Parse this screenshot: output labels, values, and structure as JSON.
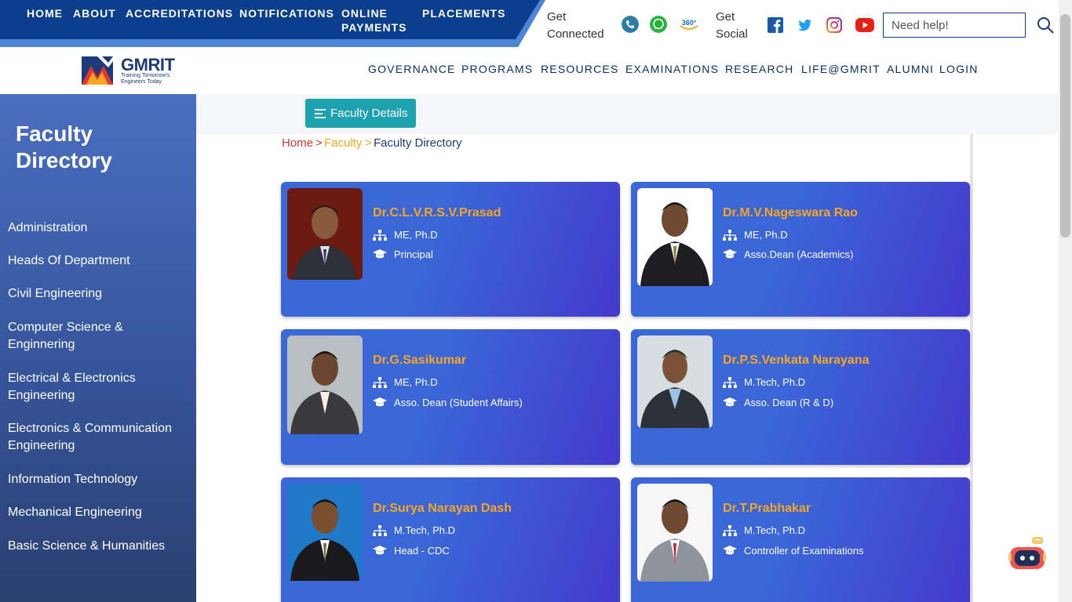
{
  "topnav": {
    "items": [
      "HOME",
      "ABOUT",
      "ACCREDITATIONS",
      "NOTIFICATIONS",
      "ONLINE PAYMENTS",
      "PLACEMENTS"
    ]
  },
  "connect": {
    "get_connected": "Get Connected",
    "get_social": "Get Social",
    "icons": [
      "phone-icon",
      "whatsapp-icon",
      "360-icon"
    ],
    "social": [
      "facebook-icon",
      "twitter-icon",
      "instagram-icon",
      "youtube-icon"
    ]
  },
  "search": {
    "placeholder": "Need help!"
  },
  "logo": {
    "name": "GMRIT",
    "tagline_1": "Training Tomorrow's",
    "tagline_2": "Engineers Today"
  },
  "mainnav": {
    "items": [
      "GOVERNANCE",
      "PROGRAMS",
      "RESOURCES",
      "EXAMINATIONS",
      "RESEARCH",
      "LIFE@GMRIT",
      "ALUMNI",
      "LOGIN"
    ]
  },
  "sidebar": {
    "title": "Faculty Directory",
    "items": [
      "Administration",
      "Heads Of Department",
      "Civil Engineering",
      "Computer Science & Enginnering",
      "Electrical & Electronics Engineering",
      "Electronics & Communication Engineering",
      "Information Technology",
      "Mechanical Engineering",
      "Basic Science & Humanities"
    ]
  },
  "faculty_button": {
    "label": "Faculty Details"
  },
  "breadcrumb": {
    "home": "Home",
    "sep": ">",
    "faculty": "Faculty",
    "current": "Faculty Directory"
  },
  "faculty": [
    {
      "name": "Dr.C.L.V.R.S.V.Prasad",
      "qualification": "ME, Ph.D",
      "role": "Principal"
    },
    {
      "name": "Dr.M.V.Nageswara Rao",
      "qualification": "ME, Ph.D",
      "role": "Asso.Dean (Academics)"
    },
    {
      "name": "Dr.G.Sasikumar",
      "qualification": "ME, Ph.D",
      "role": "Asso. Dean (Student Affairs)"
    },
    {
      "name": "Dr.P.S.Venkata Narayana",
      "qualification": "M.Tech, Ph.D",
      "role": "Asso. Dean (R & D)"
    },
    {
      "name": "Dr.Surya Narayan Dash",
      "qualification": "M.Tech, Ph.D",
      "role": "Head - CDC"
    },
    {
      "name": "Dr.T.Prabhakar",
      "qualification": "M.Tech, Ph.D",
      "role": "Controller of Examinations"
    }
  ],
  "colors": {
    "nav_dark": "#0b3f8e",
    "nav_light": "#4d86d8",
    "accent": "#f5a623",
    "teal": "#1ea2b0"
  }
}
